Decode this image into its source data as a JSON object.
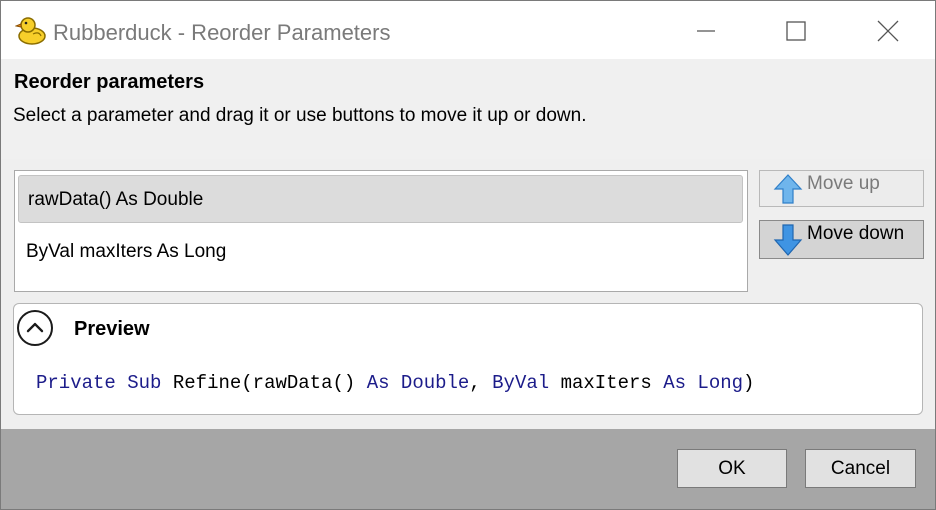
{
  "window": {
    "title": "Rubberduck - Reorder Parameters",
    "app_icon": "rubber-duck-icon"
  },
  "header": {
    "title": "Reorder parameters",
    "description": "Select a parameter and drag it or use buttons to move it up or down."
  },
  "parameters": [
    {
      "label": "rawData() As Double",
      "selected": true
    },
    {
      "label": "ByVal maxIters As Long",
      "selected": false
    }
  ],
  "buttons": {
    "move_up": "Move up",
    "move_up_enabled": false,
    "move_down": "Move down",
    "ok": "OK",
    "cancel": "Cancel"
  },
  "preview": {
    "title": "Preview",
    "code": {
      "t1": "Private",
      "t2": "Sub",
      "t3": "Refine(rawData()",
      "t4": "As",
      "t5": "Double",
      "t6": ",",
      "t7": "ByVal",
      "t8": "maxIters",
      "t9": "As",
      "t10": "Long",
      "t11": ")"
    }
  },
  "colors": {
    "keyword": "#1c1c8a",
    "header_bg": "#f0f0f0",
    "footer_bg": "#a6a6a6",
    "selection_bg": "#dcdcdc",
    "arrow_blue": "#2f8fe0"
  }
}
